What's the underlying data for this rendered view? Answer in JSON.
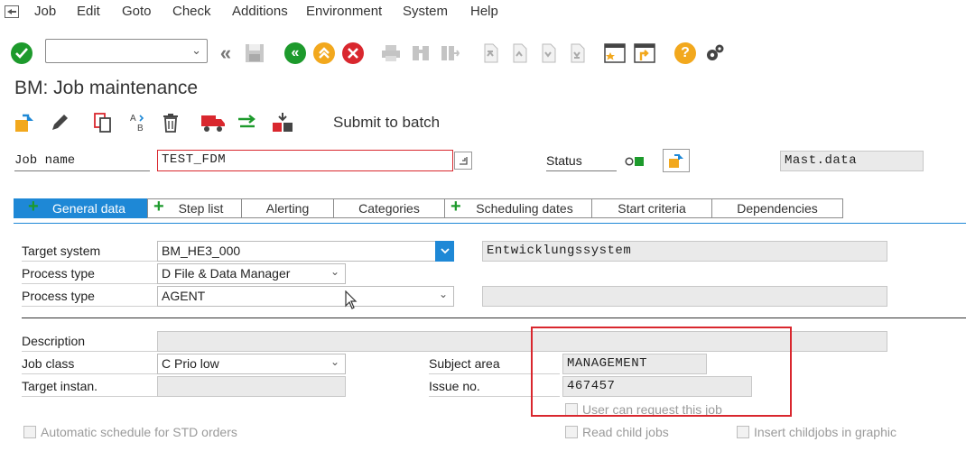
{
  "menu": {
    "items": [
      "Job",
      "Edit",
      "Goto",
      "Check",
      "Additions",
      "Environment",
      "System",
      "Help"
    ]
  },
  "toolbar": {
    "command_value": "",
    "icons": [
      "enter-icon",
      "back-icon",
      "save-icon",
      "nav-back-icon",
      "exit-icon",
      "cancel-icon",
      "print-icon",
      "find-icon",
      "find-next-icon",
      "first-page-icon",
      "prev-page-icon",
      "next-page-icon",
      "last-page-icon",
      "create-session-icon",
      "shortcut-icon",
      "help-icon",
      "settings-icon"
    ]
  },
  "page": {
    "title": "BM: Job maintenance"
  },
  "app_toolbar": {
    "submit_label": "Submit to batch"
  },
  "header": {
    "job_name_label": "Job name",
    "job_name_value": "TEST_FDM",
    "status_label": "Status",
    "mast_data_value": "Mast.data"
  },
  "tabs": [
    {
      "label": "General data",
      "plus": true,
      "active": true
    },
    {
      "label": "Step list",
      "plus": true,
      "active": false
    },
    {
      "label": "Alerting",
      "plus": false,
      "active": false
    },
    {
      "label": "Categories",
      "plus": false,
      "active": false
    },
    {
      "label": "Scheduling dates",
      "plus": true,
      "active": false
    },
    {
      "label": "Start criteria",
      "plus": false,
      "active": false
    },
    {
      "label": "Dependencies",
      "plus": false,
      "active": false
    }
  ],
  "form": {
    "target_system_label": "Target system",
    "target_system_value": "BM_HE3_000",
    "target_system_desc": "Entwicklungssystem",
    "process_type1_label": "Process type",
    "process_type1_value": "D File & Data Manager",
    "process_type2_label": "Process type",
    "process_type2_value": "AGENT",
    "description_label": "Description",
    "description_value": "",
    "job_class_label": "Job class",
    "job_class_value": "C Prio low",
    "target_instance_label": "Target instan.",
    "target_instance_value": "",
    "subject_area_label": "Subject area",
    "subject_area_value": "MANAGEMENT",
    "issue_no_label": "Issue no.",
    "issue_no_value": "467457",
    "user_can_request_label": "User can request this job",
    "auto_schedule_label": "Automatic schedule for STD orders",
    "read_child_label": "Read child jobs",
    "insert_child_label": "Insert childjobs in graphic"
  },
  "colors": {
    "accent": "#1e88d6",
    "enter_green": "#1d9a2c",
    "cancel_red": "#d9272e",
    "help_orange": "#f2a81d",
    "highlight_box": "#d9272e"
  }
}
